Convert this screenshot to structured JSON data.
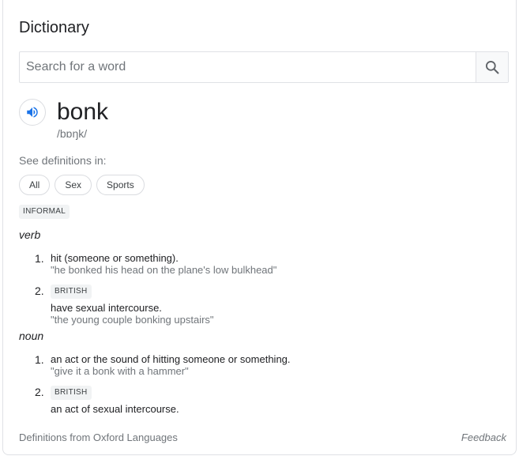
{
  "title": "Dictionary",
  "search": {
    "placeholder": "Search for a word"
  },
  "entry": {
    "word": "bonk",
    "phonetic": "/bɒŋk/"
  },
  "see_definitions_label": "See definitions in:",
  "chips": [
    "All",
    "Sex",
    "Sports"
  ],
  "register_label": "INFORMAL",
  "senses": [
    {
      "pos": "verb",
      "definitions": [
        {
          "number": "1.",
          "badge": null,
          "text": "hit (someone or something).",
          "example": "\"he bonked his head on the plane's low bulkhead\""
        },
        {
          "number": "2.",
          "badge": "BRITISH",
          "text": "have sexual intercourse.",
          "example": "\"the young couple bonking upstairs\""
        }
      ]
    },
    {
      "pos": "noun",
      "definitions": [
        {
          "number": "1.",
          "badge": null,
          "text": "an act or the sound of hitting someone or something.",
          "example": "\"give it a bonk with a hammer\""
        },
        {
          "number": "2.",
          "badge": "BRITISH",
          "text": "an act of sexual intercourse.",
          "example": null
        }
      ]
    }
  ],
  "footer": {
    "source": "Definitions from Oxford Languages",
    "feedback": "Feedback"
  },
  "colors": {
    "speaker_blue": "#1a73e8",
    "secondary_text": "#70757a",
    "border": "#dfe1e5"
  },
  "icons": {
    "speaker": "volume-up-icon",
    "search": "search-icon"
  }
}
